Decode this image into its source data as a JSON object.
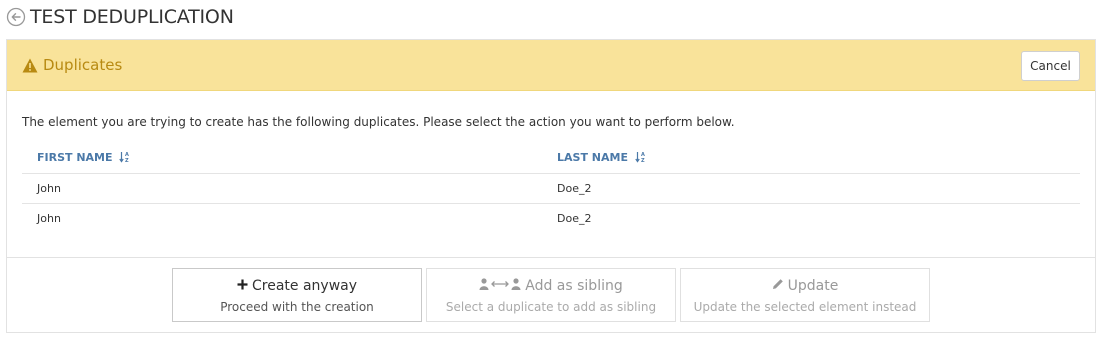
{
  "page": {
    "title": "TEST DEDUPLICATION",
    "back_icon": "arrow-left-circle-icon"
  },
  "panel": {
    "title": "Duplicates",
    "title_icon": "warning-icon",
    "cancel_label": "Cancel",
    "intro": "The element you are trying to create has the following duplicates. Please select the action you want to perform below."
  },
  "table": {
    "headers": [
      "FIRST NAME",
      "LAST NAME"
    ],
    "sort_icon": "sort-alpha-icon",
    "rows": [
      {
        "first_name": "John",
        "last_name": "Doe_2"
      },
      {
        "first_name": "John",
        "last_name": "Doe_2"
      }
    ]
  },
  "actions": {
    "create": {
      "label": "Create anyway",
      "subtitle": "Proceed with the creation",
      "icon": "plus-icon",
      "enabled": true
    },
    "sibling": {
      "label": "Add as sibling",
      "subtitle": "Select a duplicate to add as sibling",
      "icon": "user-link-icon",
      "enabled": false
    },
    "update": {
      "label": "Update",
      "subtitle": "Update the selected element instead",
      "icon": "pencil-icon",
      "enabled": false
    }
  },
  "colors": {
    "heading_bg": "#f9e39a",
    "heading_text": "#b88a12",
    "header_link": "#4b79a8"
  }
}
